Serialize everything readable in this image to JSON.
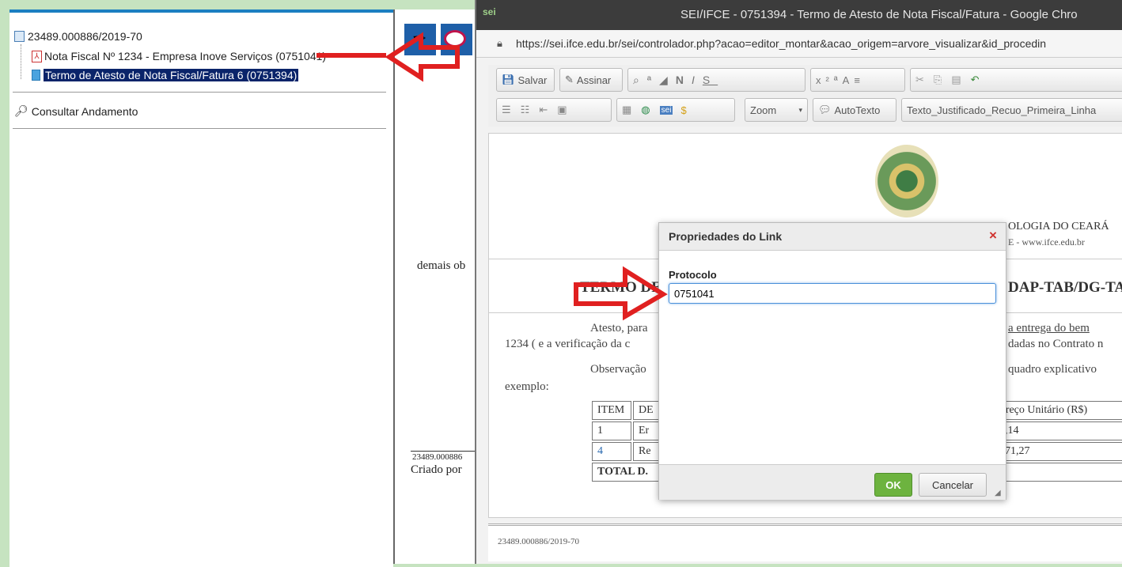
{
  "tree": {
    "process_number": "23489.000886/2019-70",
    "doc1_label": "Nota Fiscal Nº 1234 - Empresa Inove Serviços (0751041)",
    "doc2_label": "Termo de Atesto de Nota Fiscal/Fatura 6 (0751394)",
    "consult_label": "Consultar Andamento"
  },
  "middle": {
    "text_demais": "demais ob",
    "footer_ref": "23489.000886",
    "criado_por": "Criado por"
  },
  "browser": {
    "sei_badge": "sei",
    "title": "SEI/IFCE - 0751394 - Termo de Atesto de Nota Fiscal/Fatura - Google Chro",
    "url": "https://sei.ifce.edu.br/sei/controlador.php?acao=editor_montar&acao_origem=arvore_visualizar&id_procedin"
  },
  "toolbar": {
    "save_label": "Salvar",
    "sign_label": "Assinar",
    "zoom_label": "Zoom",
    "autotext_label": "AutoTexto",
    "style_label": "Texto_Justificado_Recuo_Primeira_Linha"
  },
  "doc": {
    "header_line1": "OLOGIA DO CEARÁ",
    "header_line2": "E - www.ifce.edu.br",
    "title_left": "TERMO DE",
    "title_right": "DAP-TAB/DG-TA",
    "p1_a": "Atesto, para",
    "p1_b": "a entrega do bem",
    "p1_c": "1234 (  e a verificação da c",
    "p1_d": "dadas no Contrato n",
    "p2_a": "Observação",
    "p2_b": "quadro explicativo",
    "p2_c": "exemplo:",
    "table": {
      "headers": [
        "ITEM",
        "DE",
        "Preço Unitário (R$)"
      ],
      "rows": [
        [
          "1",
          "Er",
          "1,14"
        ],
        [
          "4",
          "Re",
          "571,27"
        ]
      ],
      "total": "TOTAL D."
    },
    "footer_ref": "23489.000886/2019-70"
  },
  "dialog": {
    "title": "Propriedades do Link",
    "close": "×",
    "field_label": "Protocolo",
    "field_value": "0751041",
    "ok_label": "OK",
    "cancel_label": "Cancelar"
  },
  "colors": {
    "accent_blue": "#1b7fc1",
    "annotation_red": "#e02020",
    "ok_green": "#6db33f",
    "selection_bg": "#0a246a"
  }
}
